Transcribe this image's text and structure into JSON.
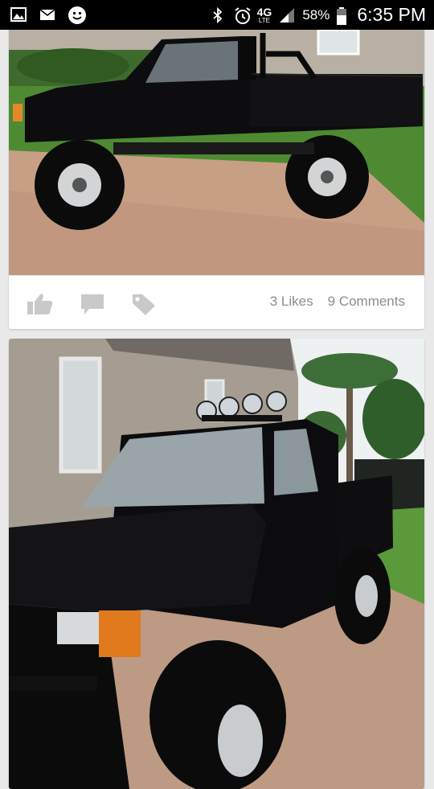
{
  "status_bar": {
    "battery_percent": "58%",
    "time": "6:35 PM",
    "network_label": "4G",
    "network_sub": "LTE",
    "icons": [
      "gallery-icon",
      "mail-icon",
      "emoji-icon",
      "bluetooth-icon",
      "alarm-icon",
      "network-icon",
      "signal-icon",
      "battery-icon"
    ]
  },
  "posts": [
    {
      "image_subject": "truck-side-view",
      "likes": "3 Likes",
      "comments": "9 Comments",
      "actions": [
        "like-icon",
        "comment-icon",
        "tag-icon"
      ]
    },
    {
      "image_subject": "truck-front-view"
    }
  ],
  "colors": {
    "background": "#e9e9ea",
    "action_icon": "#c9c9c9",
    "count_text": "#8c8c8c",
    "status_bar": "#000000"
  }
}
